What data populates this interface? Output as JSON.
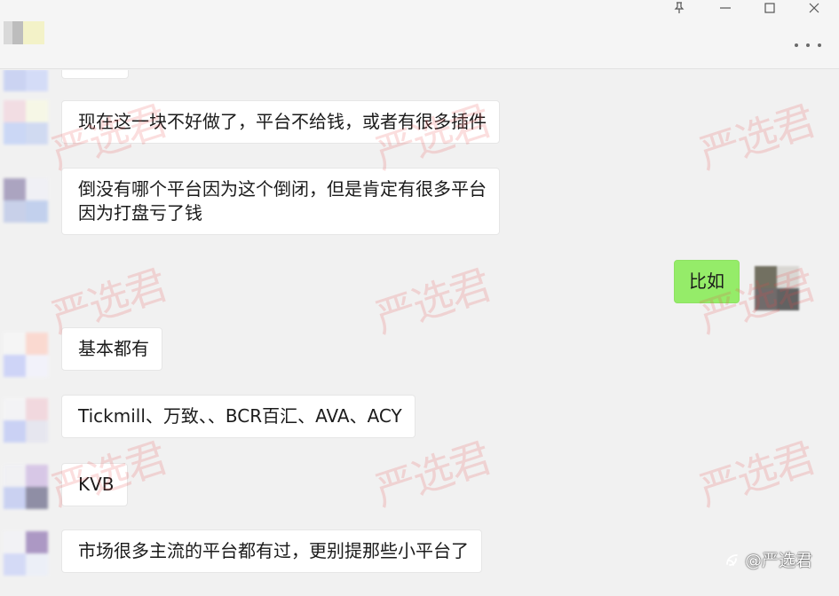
{
  "window": {
    "pin_label": "pin",
    "minimize_label": "minimize",
    "maximize_label": "maximize",
    "close_label": "close"
  },
  "chat": {
    "messages": [
      {
        "sender": "other",
        "text": "现在这一块不好做了，平台不给钱，或者有很多插件"
      },
      {
        "sender": "other",
        "text": "倒没有哪个平台因为这个倒闭，但是肯定有很多平台\n因为打盘亏了钱"
      },
      {
        "sender": "self",
        "text": "比如"
      },
      {
        "sender": "other",
        "text": "基本都有"
      },
      {
        "sender": "other",
        "text": "Tickmill、万致、、BCR百汇、AVA、ACY"
      },
      {
        "sender": "other",
        "text": "KVB"
      },
      {
        "sender": "other",
        "text": "市场很多主流的平台都有过，更别提那些小平台了"
      }
    ]
  },
  "watermark": {
    "text": "严选君"
  },
  "footer": {
    "handle": "@严选君"
  },
  "colors": {
    "self_bubble": "#95ec69",
    "other_bubble": "#ffffff",
    "background": "#f1f1f1",
    "watermark": "#e84646"
  }
}
